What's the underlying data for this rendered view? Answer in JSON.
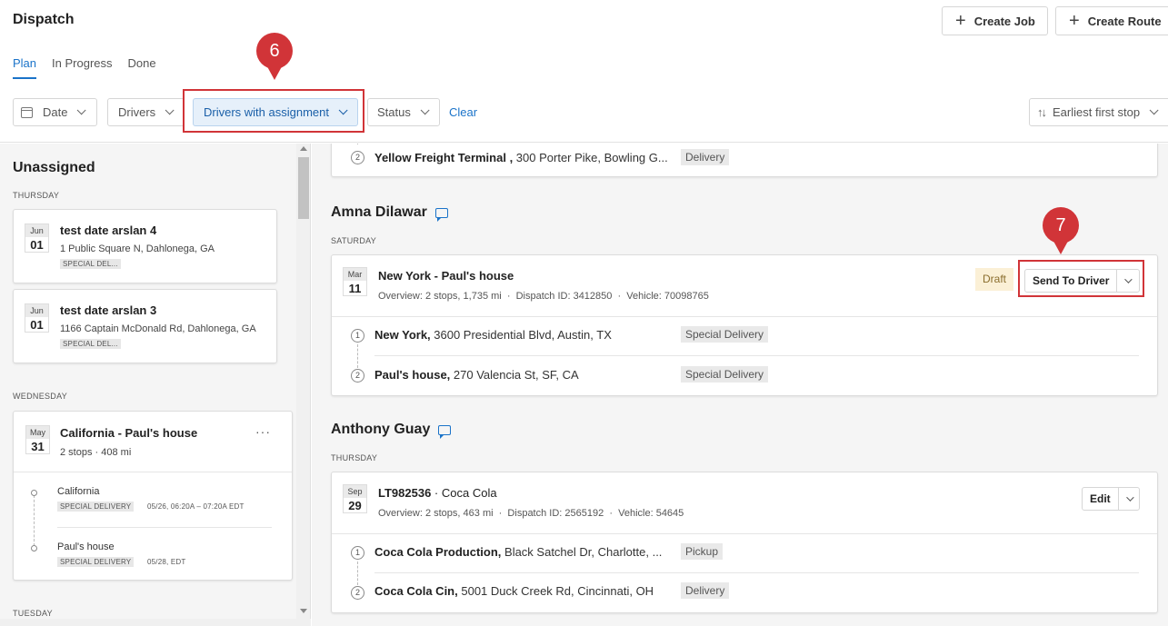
{
  "header": {
    "title": "Dispatch",
    "create_job": "Create Job",
    "create_route": "Create Route"
  },
  "tabs": [
    {
      "label": "Plan",
      "active": true
    },
    {
      "label": "In Progress",
      "active": false
    },
    {
      "label": "Done",
      "active": false
    }
  ],
  "filters": {
    "date": "Date",
    "drivers": "Drivers",
    "assignment": "Drivers with assignment",
    "status": "Status",
    "clear": "Clear",
    "sort": "Earliest first stop"
  },
  "callouts": {
    "step6": "6",
    "step7": "7"
  },
  "unassigned": {
    "title": "Unassigned",
    "day1": "THURSDAY",
    "jobs": [
      {
        "month": "Jun",
        "day": "01",
        "title": "test date arslan 4",
        "address": "1 Public Square N, Dahlonega, GA",
        "tag": "SPECIAL DEL..."
      },
      {
        "month": "Jun",
        "day": "01",
        "title": "test date arslan 3",
        "address": "1166 Captain McDonald Rd, Dahlonega, GA",
        "tag": "SPECIAL DEL..."
      }
    ],
    "day2": "WEDNESDAY",
    "route": {
      "month": "May",
      "day": "31",
      "title": "California - Paul's house",
      "summary": "2 stops · 408 mi",
      "more": "···",
      "stops": [
        {
          "name": "California",
          "tag": "SPECIAL DELIVERY",
          "time": "05/26, 06:20A – 07:20A EDT"
        },
        {
          "name": "Paul's house",
          "tag": "SPECIAL DELIVERY",
          "time": "05/28, EDT"
        }
      ]
    },
    "day3": "TUESDAY"
  },
  "routes": {
    "top_partial": {
      "num": "2",
      "name": "Yellow Freight Terminal ,",
      "address": " 300 Porter Pike, Bowling G...",
      "tag": "Delivery"
    },
    "amna": {
      "driver": "Amna Dilawar",
      "day": "SATURDAY",
      "month": "Mar",
      "date": "11",
      "title": "New York - Paul's house",
      "overview": "Overview: 2 stops, 1,735 mi  ·  Dispatch ID: 3412850  ·  Vehicle: 70098765",
      "status": "Draft",
      "action": "Send To Driver",
      "stops": [
        {
          "num": "1",
          "name": "New York,",
          "address": " 3600 Presidential Blvd, Austin, TX",
          "tag": "Special Delivery"
        },
        {
          "num": "2",
          "name": "Paul's house,",
          "address": " 270 Valencia St, SF, CA",
          "tag": "Special Delivery"
        }
      ]
    },
    "anthony": {
      "driver": "Anthony Guay",
      "day": "THURSDAY",
      "month": "Sep",
      "date": "29",
      "title": "LT982536",
      "title_sep": " · ",
      "customer": "Coca Cola",
      "overview": "Overview: 2 stops, 463 mi  ·  Dispatch ID: 2565192  ·  Vehicle: 54645",
      "action": "Edit",
      "stops": [
        {
          "num": "1",
          "name": "Coca Cola Production,",
          "address": " Black Satchel Dr, Charlotte, ...",
          "tag": "Pickup"
        },
        {
          "num": "2",
          "name": "Coca Cola Cin,",
          "address": " 5001 Duck Creek Rd, Cincinnati, OH",
          "tag": "Delivery"
        }
      ]
    }
  }
}
